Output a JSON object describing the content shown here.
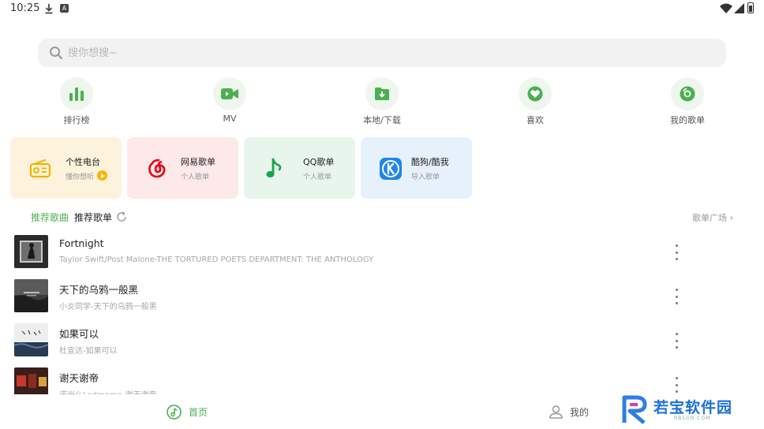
{
  "status": {
    "time": "10:25",
    "app_badge": "A"
  },
  "search": {
    "placeholder": "搜你想搜~",
    "value": ""
  },
  "quick_nav": [
    {
      "label": "排行榜",
      "icon": "chart-bars-icon"
    },
    {
      "label": "MV",
      "icon": "video-camera-icon"
    },
    {
      "label": "本地/下载",
      "icon": "folder-download-icon"
    },
    {
      "label": "喜欢",
      "icon": "heart-icon"
    },
    {
      "label": "我的歌单",
      "icon": "disc-icon"
    }
  ],
  "cards": [
    {
      "title": "个性电台",
      "subtitle": "懂你想听",
      "bg": "#fdf3dc",
      "icon": "radio-icon"
    },
    {
      "title": "网易歌单",
      "subtitle": "个人歌单",
      "bg": "#fde8ea",
      "icon": "netease-icon"
    },
    {
      "title": "QQ歌单",
      "subtitle": "个人歌单",
      "bg": "#e8f5ec",
      "icon": "qq-music-icon"
    },
    {
      "title": "酷狗/酷我",
      "subtitle": "导入歌单",
      "bg": "#e6f1fc",
      "icon": "kugou-icon"
    }
  ],
  "tabs": {
    "songs": "推荐歌曲",
    "playlists": "推荐歌单"
  },
  "more_playlists": "歌单广场",
  "songs": [
    {
      "title": "Fortnight",
      "subtitle": "Taylor Swift/Post Malone-THE TORTURED POETS DEPARTMENT: THE ANTHOLOGY"
    },
    {
      "title": "天下的乌鸦一般黑",
      "subtitle": "小炎同学-天下的乌鸦一般黑"
    },
    {
      "title": "如果可以",
      "subtitle": "杜宣达-如果可以"
    },
    {
      "title": "谢天谢帝",
      "subtitle": "诺米么Lodmemo-谢天谢帝"
    }
  ],
  "bottom_nav": {
    "home": "首页",
    "mine": "我的"
  },
  "watermark": {
    "text": "若宝软件园",
    "sub": "RBSGN.COM"
  },
  "colors": {
    "accent": "#4caf50",
    "icon_bg": "#eef6ee"
  }
}
